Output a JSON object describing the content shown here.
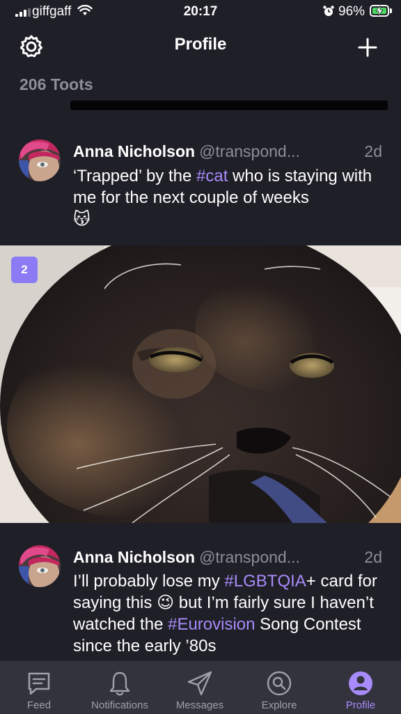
{
  "status_bar": {
    "carrier": "giffgaff",
    "time": "20:17",
    "battery_percent": "96%"
  },
  "nav": {
    "title": "Profile",
    "settings_icon": "gear-icon",
    "add_icon": "plus-icon"
  },
  "profile": {
    "toots_count": "206 Toots"
  },
  "posts": [
    {
      "author": "Anna Nicholson",
      "handle": "@transpond...",
      "time": "2d",
      "text_1": "‘Trapped’ by the ",
      "hashtag_1": "#cat",
      "text_2": " who is staying with me for the next couple of weeks",
      "emoji": "😽",
      "media_count": "2"
    },
    {
      "author": "Anna Nicholson",
      "handle": "@transpond...",
      "time": "2d",
      "text_1": "I’ll probably lose my ",
      "hashtag_1": "#LGBTQIA",
      "text_2": "+ card for saying this ",
      "emoji": "😉",
      "text_3": " but I’m fairly sure I haven’t watched the ",
      "hashtag_2": "#Eurovision",
      "text_4": " Song Contest since the early ’80s"
    }
  ],
  "tab_bar": {
    "tabs": [
      {
        "label": "Feed",
        "icon": "chat-bubble-icon"
      },
      {
        "label": "Notifications",
        "icon": "bell-icon"
      },
      {
        "label": "Messages",
        "icon": "paper-plane-icon"
      },
      {
        "label": "Explore",
        "icon": "search-icon"
      },
      {
        "label": "Profile",
        "icon": "person-icon"
      }
    ],
    "active_tab": "Profile",
    "accent_color": "#a78bfa"
  }
}
